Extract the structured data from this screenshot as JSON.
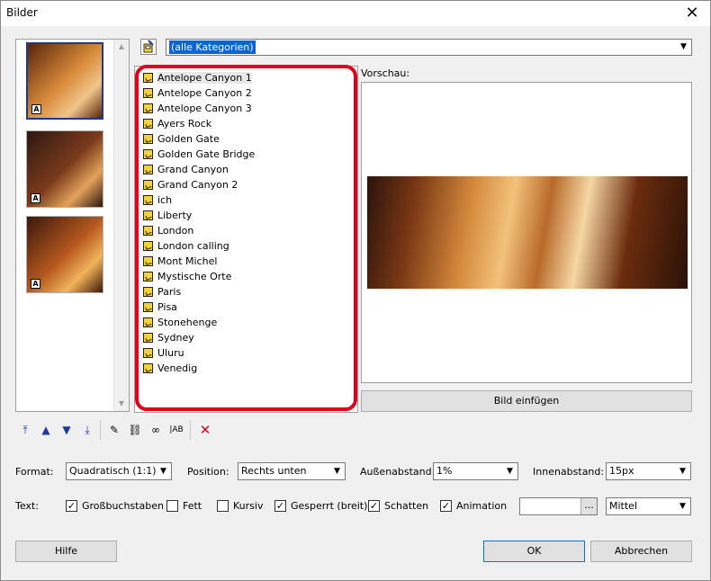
{
  "window": {
    "title": "Bilder",
    "close_icon": "close-icon"
  },
  "category": {
    "selected": "(alle Kategorien)"
  },
  "thumbnails": [
    {
      "badge": "A",
      "colors": [
        "#5a240b",
        "#d98b3a",
        "#f0c58a"
      ],
      "selected": true
    },
    {
      "badge": "A",
      "colors": [
        "#2d1710",
        "#7a3b1c",
        "#e3a25a"
      ],
      "selected": false
    },
    {
      "badge": "A",
      "colors": [
        "#3a180b",
        "#b5571f",
        "#f2b35a"
      ],
      "selected": false
    }
  ],
  "image_list": [
    "Antelope Canyon 1",
    "Antelope Canyon 2",
    "Antelope Canyon 3",
    "Ayers Rock",
    "Golden Gate",
    "Golden Gate Bridge",
    "Grand Canyon",
    "Grand Canyon 2",
    "ich",
    "Liberty",
    "London",
    "London calling",
    "Mont Michel",
    "Mystische Orte",
    "Paris",
    "Pisa",
    "Stonehenge",
    "Sydney",
    "Uluru",
    "Venedig"
  ],
  "preview": {
    "label": "Vorschau:",
    "insert_button": "Bild einfügen"
  },
  "form": {
    "format_label": "Format:",
    "format_value": "Quadratisch (1:1)",
    "position_label": "Position:",
    "position_value": "Rechts unten",
    "aussen_label": "Außenabstand:",
    "aussen_value": "1%",
    "innen_label": "Innenabstand:",
    "innen_value": "15px",
    "text_label": "Text:",
    "checkboxes": [
      {
        "label": "Großbuchstaben",
        "checked": true
      },
      {
        "label": "Fett",
        "checked": false
      },
      {
        "label": "Kursiv",
        "checked": false
      },
      {
        "label": "Gesperrt (breit)",
        "checked": true
      },
      {
        "label": "Schatten",
        "checked": true
      },
      {
        "label": "Animation",
        "checked": true
      }
    ],
    "ellipsis": "...",
    "speed_value": "Mittel"
  },
  "buttons": {
    "help": "Hilfe",
    "ok": "OK",
    "cancel": "Abbrechen"
  },
  "colors": {
    "accent": "#0a64d6",
    "highlight": "#e0001b",
    "toolbar_icon": "#1b3aa3",
    "delete": "#e0001b"
  }
}
